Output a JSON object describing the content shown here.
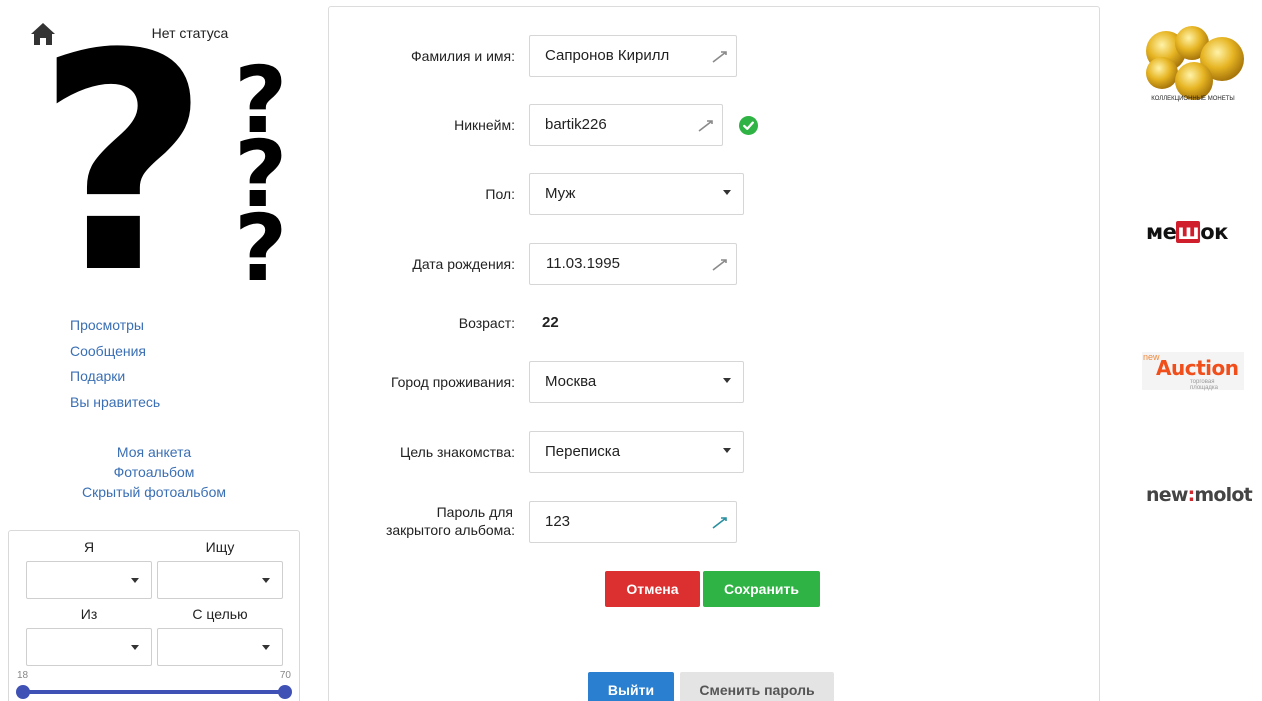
{
  "header": {
    "status": "Нет статуса",
    "home_icon": "home-icon"
  },
  "avatar": {
    "placeholder_glyph": "?"
  },
  "profile_links": [
    {
      "label": "Просмотры"
    },
    {
      "label": "Сообщения"
    },
    {
      "label": "Подарки"
    },
    {
      "label": "Вы нравитесь"
    }
  ],
  "nav_links": [
    {
      "label": "Моя анкета"
    },
    {
      "label": "Фотоальбом"
    },
    {
      "label": "Скрытый фотоальбом"
    }
  ],
  "search": {
    "i_label": "Я",
    "seek_label": "Ищу",
    "from_label": "Из",
    "purpose_label": "С целью",
    "age_min": "18",
    "age_max": "70"
  },
  "form": {
    "name_label": "Фамилия и имя:",
    "name_value": "Сапронов Кирилл",
    "nick_label": "Никнейм:",
    "nick_value": "bartik226",
    "gender_label": "Пол:",
    "gender_value": "Муж",
    "birth_label": "Дата рождения:",
    "birth_value": "11.03.1995",
    "age_label": "Возраст:",
    "age_value": "22",
    "city_label": "Город проживания:",
    "city_value": "Москва",
    "goal_label": "Цель знакомства:",
    "goal_value": "Переписка",
    "password_label_1": "Пароль для",
    "password_label_2": "закрытого альбома:",
    "password_value": "123"
  },
  "buttons": {
    "cancel": "Отмена",
    "save": "Сохранить",
    "logout": "Выйти",
    "change_password": "Сменить пароль"
  },
  "ads": {
    "coins_caption": "КОЛЛЕКЦИОННЫЕ МОНЕТЫ",
    "meshok_pre": "ме",
    "meshok_mid": "ш",
    "meshok_post": "ок",
    "auction_new": "new",
    "auction_big": "Auction",
    "auction_sub": "торговая площадка",
    "newmolot_pre": "new",
    "newmolot_post": "molot"
  },
  "colors": {
    "link": "#3a6fb4",
    "cancel": "#dc2f2f",
    "save": "#2fb344",
    "logout": "#2a7fd0",
    "slider": "#3f51b5",
    "check": "#2fb344"
  }
}
